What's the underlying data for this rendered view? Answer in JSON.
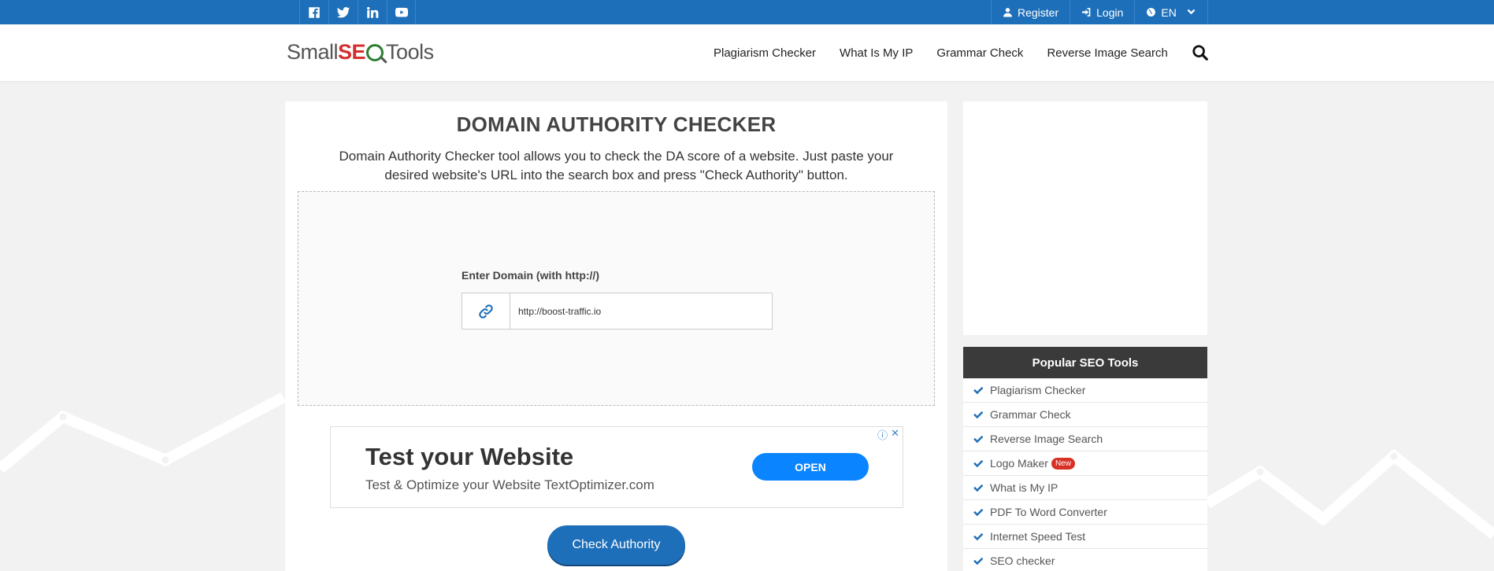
{
  "topbar": {
    "social": [
      {
        "name": "facebook-icon"
      },
      {
        "name": "twitter-icon"
      },
      {
        "name": "linkedin-icon"
      },
      {
        "name": "youtube-icon"
      }
    ],
    "register_label": "Register",
    "login_label": "Login",
    "language_label": "EN"
  },
  "header": {
    "logo": {
      "small": "Small",
      "s": "S",
      "e": "E",
      "tools": "Tools"
    },
    "nav": [
      "Plagiarism Checker",
      "What Is My IP",
      "Grammar Check",
      "Reverse Image Search"
    ]
  },
  "main": {
    "title": "DOMAIN AUTHORITY CHECKER",
    "description": "Domain Authority Checker tool allows you to check the DA score of a website. Just paste your desired website's URL into the search box and press \"Check Authority\" button.",
    "field_label": "Enter Domain (with http://)",
    "field_value": "http://boost-traffic.io",
    "ad": {
      "title": "Test your Website",
      "subtitle": "Test & Optimize your Website TextOptimizer.com",
      "open_label": "OPEN"
    },
    "check_button": "Check Authority"
  },
  "sidebar": {
    "popular_title": "Popular SEO Tools",
    "items": [
      {
        "label": "Plagiarism Checker"
      },
      {
        "label": "Grammar Check"
      },
      {
        "label": "Reverse Image Search"
      },
      {
        "label": "Logo Maker",
        "badge": "New"
      },
      {
        "label": "What is My IP"
      },
      {
        "label": "PDF To Word Converter"
      },
      {
        "label": "Internet Speed Test"
      },
      {
        "label": "SEO checker"
      }
    ]
  },
  "colors": {
    "brand_blue": "#1e6fb9",
    "ad_open": "#0a84ff",
    "popular_head": "#3a3a3a",
    "badge_red": "#d93025"
  }
}
